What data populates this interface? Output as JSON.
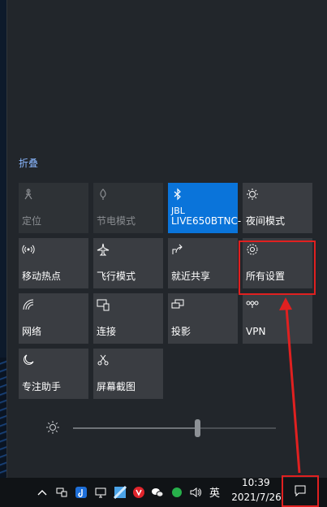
{
  "action_center": {
    "collapse_label": "折叠",
    "tiles": [
      {
        "label": "定位",
        "icon": "location-icon",
        "state": "disabled"
      },
      {
        "label": "节电模式",
        "icon": "battery-saver-icon",
        "state": "disabled"
      },
      {
        "label": "JBL",
        "label2": "LIVE650BTNC-",
        "icon": "bluetooth-icon",
        "state": "active"
      },
      {
        "label": "夜间模式",
        "icon": "night-light-icon",
        "state": "normal"
      },
      {
        "label": "移动热点",
        "icon": "mobile-hotspot-icon",
        "state": "normal"
      },
      {
        "label": "飞行模式",
        "icon": "airplane-icon",
        "state": "normal"
      },
      {
        "label": "就近共享",
        "icon": "nearby-sharing-icon",
        "state": "normal"
      },
      {
        "label": "所有设置",
        "icon": "settings-gear-icon",
        "state": "normal"
      },
      {
        "label": "网络",
        "icon": "network-icon",
        "state": "normal"
      },
      {
        "label": "连接",
        "icon": "connect-icon",
        "state": "normal"
      },
      {
        "label": "投影",
        "icon": "project-icon",
        "state": "normal"
      },
      {
        "label": "VPN",
        "icon": "vpn-icon",
        "state": "normal"
      },
      {
        "label": "专注助手",
        "icon": "focus-assist-moon-icon",
        "state": "normal"
      },
      {
        "label": "屏幕截图",
        "icon": "screen-snip-icon",
        "state": "normal"
      }
    ],
    "brightness": {
      "icon": "brightness-sun-icon",
      "level": 0.61
    }
  },
  "taskbar": {
    "tray_icons": [
      "chevron-up-icon",
      "network-tray-icon",
      "app-tray-icon",
      "display-tray-icon",
      "app-blue-tray-icon",
      "app-red-tray-icon",
      "wechat-tray-icon",
      "speaker-icon"
    ],
    "ime": "英",
    "time": "10:39",
    "date": "2021/7/26",
    "notification_icon": "notification-icon"
  },
  "colors": {
    "accent": "#0a74da",
    "highlight_box": "#e02020",
    "link": "#8ab7ff"
  }
}
